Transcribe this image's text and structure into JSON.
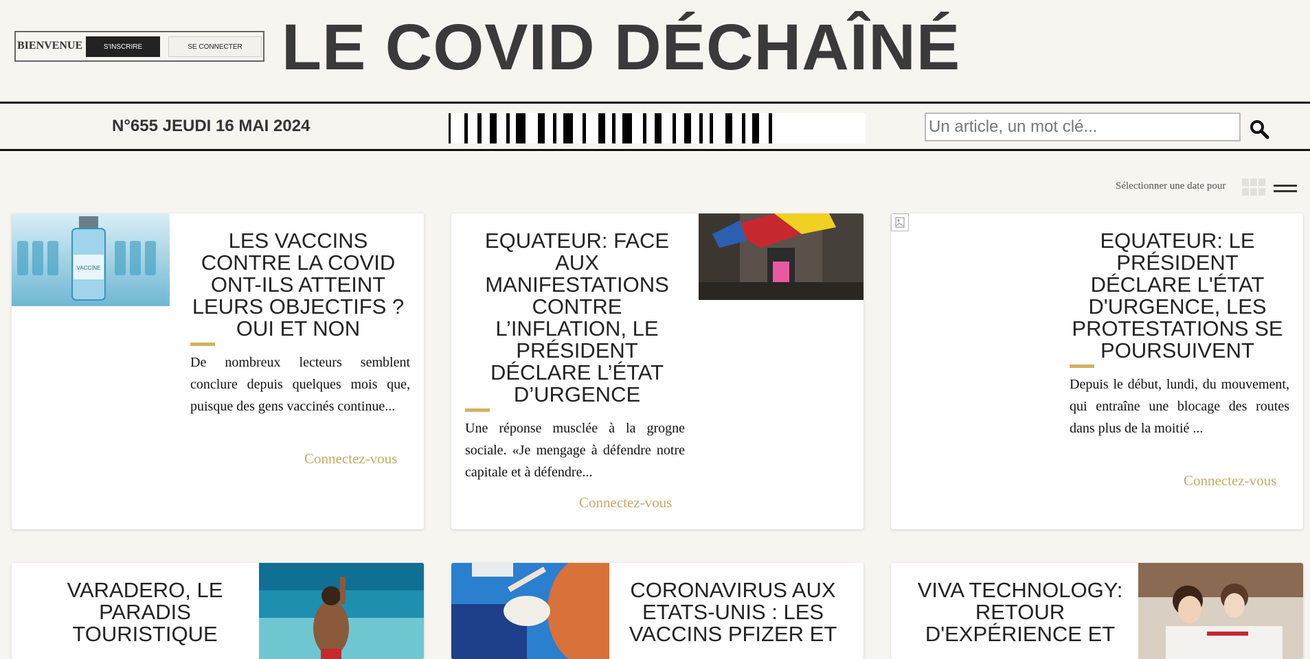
{
  "header": {
    "welcome": "BIENVENUE",
    "signup_label": "S'INSCRIRE",
    "login_label": "SE CONNECTER",
    "site_title": "LE COVID DÉCHAÎNÉ"
  },
  "issue_bar": {
    "issue_text": "N°655 JEUDI 16 MAI 2024",
    "search_placeholder": "Un article, un mot clé..."
  },
  "toolbar": {
    "date_select_label": "Sélectionner une date pour",
    "view_icons": [
      "grid-icon",
      "list-icon"
    ]
  },
  "colors": {
    "accent": "#d4b060",
    "link": "#c9aa67",
    "background": "#f7f5f0"
  },
  "articles": [
    {
      "title": "LES VACCINS CONTRE LA COVID ONT-ILS ATTEINT LEURS OBJECTIFS ? OUI ET NON",
      "excerpt": "De nombreux lecteurs semblent conclure depuis quelques mois que, puisque des gens vaccinés continue...",
      "link": "Connectez-vous"
    },
    {
      "title": "EQUATEUR: FACE AUX MANIFESTATIONS CONTRE L’INFLATION, LE PRÉSIDENT DÉCLARE L’ÉTAT D’URGENCE",
      "excerpt": "Une réponse musclée à la grogne sociale. «Je mengage à défendre notre capitale et à défendre...",
      "link": "Connectez-vous"
    },
    {
      "title": "EQUATEUR: LE PRÉSIDENT DÉCLARE L'ÉTAT D'URGENCE, LES PROTESTATIONS SE POURSUIVENT",
      "excerpt": "Depuis le début, lundi, du mouvement, qui entraîne une blocage des routes dans plus de la moitié ...",
      "link": "Connectez-vous"
    },
    {
      "title": "VARADERO, LE PARADIS TOURISTIQUE"
    },
    {
      "title": "CORONAVIRUS AUX ETATS-UNIS : LES VACCINS PFIZER ET"
    },
    {
      "title": "VIVA TECHNOLOGY: RETOUR D'EXPÉRIENCE ET"
    }
  ]
}
